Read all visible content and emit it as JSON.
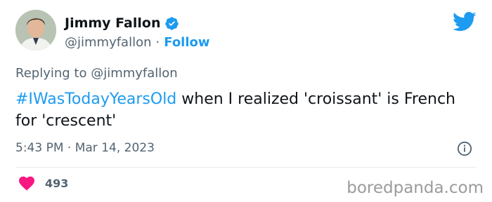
{
  "author": {
    "name": "Jimmy Fallon",
    "handle": "@jimmyfallon",
    "separator": "·",
    "follow_label": "Follow",
    "verified": true
  },
  "reply": {
    "text": "Replying to @jimmyfallon"
  },
  "tweet": {
    "hashtag": "#IWasTodayYearsOld",
    "body": " when I realized 'croissant' is French for 'crescent'"
  },
  "meta": {
    "timestamp": "5:43 PM · Mar 14, 2023"
  },
  "engagement": {
    "likes": "493"
  },
  "watermark": {
    "text": "boredpanda.com"
  },
  "colors": {
    "accent": "#1d9bf0",
    "heart": "#f91880",
    "secondary_text": "#536471"
  },
  "icons": {
    "logo": "twitter-bird-icon",
    "verified": "verified-badge-icon",
    "info": "info-icon",
    "like": "heart-icon"
  }
}
